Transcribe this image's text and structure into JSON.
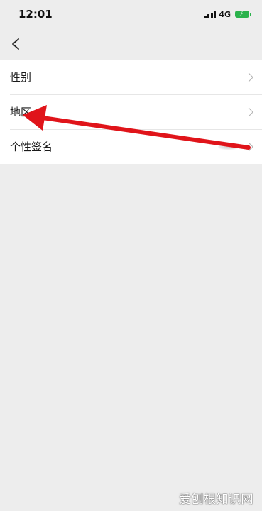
{
  "status_bar": {
    "time": "12:01",
    "network": "4G"
  },
  "nav": {
    "back_icon": "chevron-left-icon"
  },
  "settings_list": {
    "items": [
      {
        "label": "性别",
        "icon": "chevron-right-icon"
      },
      {
        "label": "地区",
        "icon": "chevron-right-icon"
      },
      {
        "label": "个性签名",
        "icon": "chevron-right-icon"
      }
    ]
  },
  "annotation": {
    "arrow_color": "#e0141a",
    "arrow_target": "地区"
  },
  "watermark": {
    "text": "爱刨根知识网"
  },
  "colors": {
    "background": "#ededed",
    "list_background": "#ffffff",
    "battery": "#2bb24c",
    "chevron": "#b2b2b2"
  }
}
